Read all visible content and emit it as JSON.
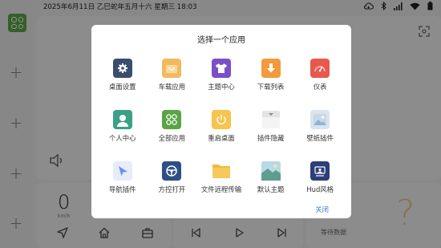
{
  "status_bar": {
    "datetime": "2025年6月11日  乙巳蛇年五月十六  星期三  18:03",
    "icons": [
      "cloud-sync-icon",
      "bluetooth-icon",
      "signal-bars-icon",
      "wifi-icon",
      "battery-icon"
    ]
  },
  "background": {
    "speed_value": "0",
    "speed_unit": "km/h",
    "weather_placeholder": "?",
    "weather_status": "等待数据"
  },
  "dialog": {
    "title": "选择一个应用",
    "close_label": "关闭",
    "apps": [
      {
        "label": "桌面设置",
        "icon": "gear-icon",
        "color": "#3b4d6e"
      },
      {
        "label": "车载应用",
        "icon": "shopping-bag-icon",
        "color": "#f3b95f"
      },
      {
        "label": "主题中心",
        "icon": "tshirt-icon",
        "color": "#7a4fc8"
      },
      {
        "label": "下载列表",
        "icon": "download-icon",
        "color": "#f29a3c"
      },
      {
        "label": "仪表",
        "icon": "gauge-icon",
        "color": "#e9584c"
      },
      {
        "label": "个人中心",
        "icon": "person-icon",
        "color": "#3aa088"
      },
      {
        "label": "全部应用",
        "icon": "app-grid-icon",
        "color": "#5aa447"
      },
      {
        "label": "重启桌面",
        "icon": "power-icon",
        "color": "#f6c44f"
      },
      {
        "label": "插件隐藏",
        "icon": "widget-hide-icon",
        "color": "#dcdcdc"
      },
      {
        "label": "壁纸插件",
        "icon": "wallpaper-icon",
        "color": "#d9e4ee"
      },
      {
        "label": "导航插件",
        "icon": "navigation-arrow-icon",
        "color": "#e6ecfb"
      },
      {
        "label": "方控打开",
        "icon": "steering-wheel-icon",
        "color": "#2e4f86"
      },
      {
        "label": "文件远程传输",
        "icon": "folder-icon",
        "color": "#f7c85a"
      },
      {
        "label": "默认主题",
        "icon": "landscape-icon",
        "color": "#6fb3a8"
      },
      {
        "label": "Hud风格",
        "icon": "hud-icon",
        "color": "#2d3f7a"
      }
    ]
  }
}
